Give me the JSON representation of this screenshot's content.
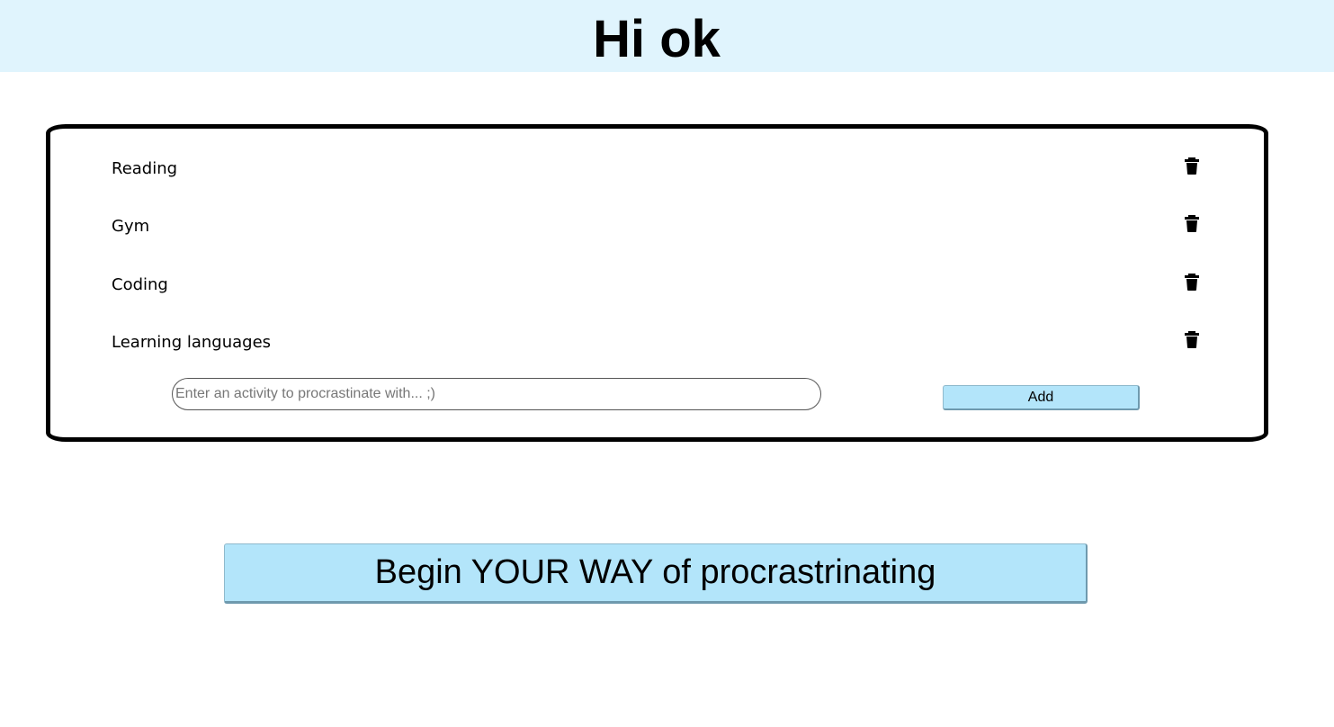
{
  "header": {
    "title": "Hi ok",
    "background": "#e0f4fd"
  },
  "activities": [
    {
      "label": "Reading",
      "icon": "trash-icon"
    },
    {
      "label": "Gym",
      "icon": "trash-icon"
    },
    {
      "label": "Coding",
      "icon": "trash-icon"
    },
    {
      "label": "Learning languages",
      "icon": "trash-icon"
    }
  ],
  "form": {
    "input_value": "",
    "input_placeholder": "Enter an activity to procrastinate with... ;)",
    "add_label": "Add"
  },
  "cta": {
    "label": "Begin YOUR WAY of procrastrinating"
  },
  "colors": {
    "button": "#b3e5fa",
    "header": "#e0f4fd"
  }
}
